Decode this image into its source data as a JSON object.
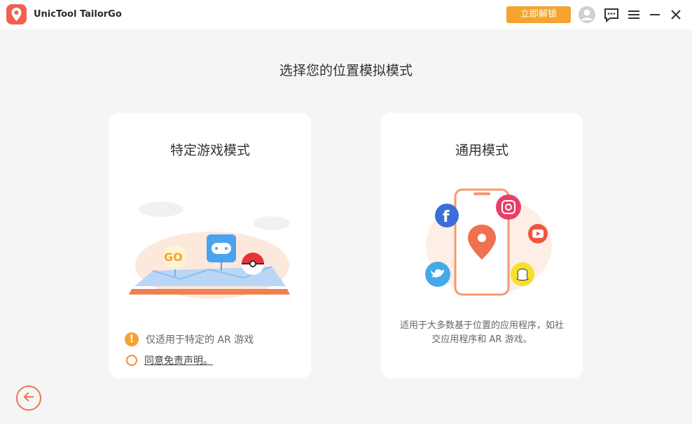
{
  "app": {
    "title": "UnicTool TailorGo",
    "unlock_button": "立即解锁",
    "icons": [
      "app-logo",
      "user-avatar-icon",
      "feedback-chat-icon",
      "menu-icon",
      "minimize-icon",
      "close-icon"
    ]
  },
  "page": {
    "heading": "选择您的位置模拟模式"
  },
  "cards": {
    "game": {
      "title": "特定游戏模式",
      "warning_text": "仅适用于特定的 AR 游戏",
      "agree_text": "同意免责声明。",
      "illustration_badge": "GO"
    },
    "general": {
      "title": "通用模式",
      "description_line1": "适用于大多数基于位置的应用程序，如社",
      "description_line2": "交应用程序和 AR 游戏。"
    }
  },
  "colors": {
    "accent_orange": "#f4a32f",
    "brand_red": "#f0614f",
    "background": "#f5f5f5",
    "card": "#ffffff"
  }
}
